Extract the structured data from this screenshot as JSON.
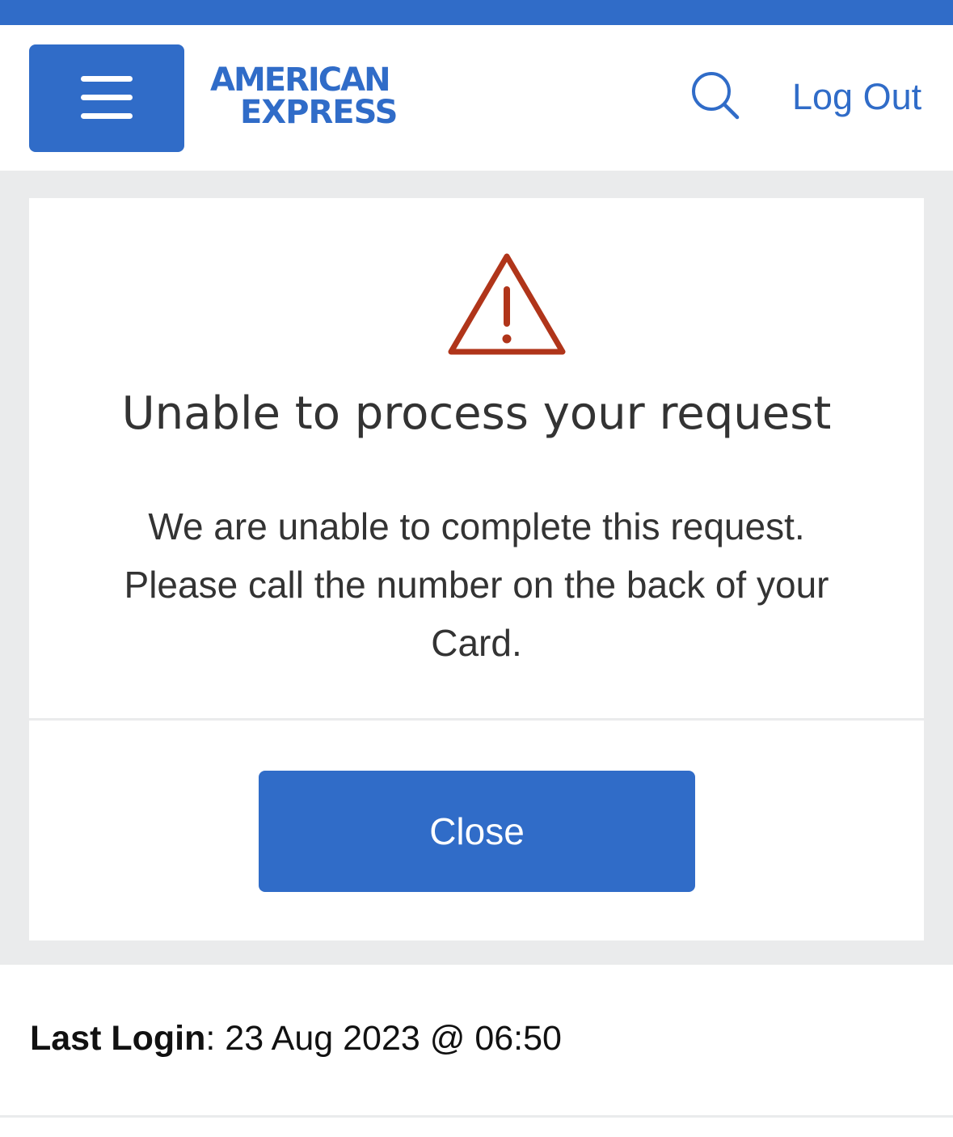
{
  "header": {
    "menu_icon": "hamburger-menu-icon",
    "logo": {
      "line1": "AMERICAN",
      "line2": "EXPRESS"
    },
    "search_icon": "search-icon",
    "logout_label": "Log Out"
  },
  "dialog": {
    "icon": "warning-triangle-icon",
    "title": "Unable to process your request",
    "message": "We are unable to complete this request. Please call the number on the back of your Card.",
    "close_label": "Close"
  },
  "footer": {
    "last_login_label": "Last Login",
    "last_login_separator": ": ",
    "last_login_value": "23 Aug 2023 @ 06:50"
  },
  "colors": {
    "brand_blue": "#306cc8",
    "warning_red": "#b0351a",
    "background_gray": "#eaebec",
    "text_dark": "#333333"
  }
}
